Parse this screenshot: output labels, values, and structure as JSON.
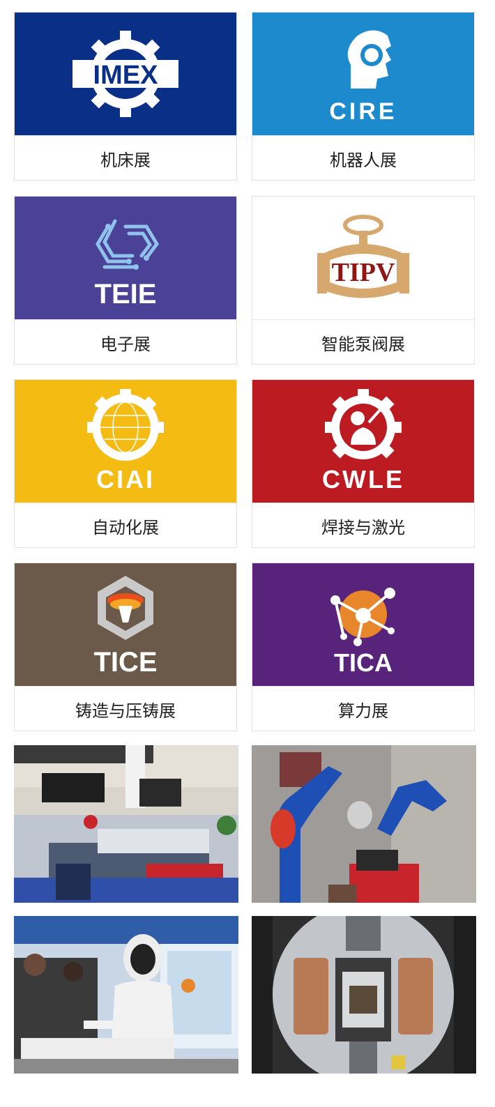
{
  "exhibitions": [
    {
      "name": "机床展",
      "logo_text": "IMEX",
      "bg": "#0A2F86"
    },
    {
      "name": "机器人展",
      "logo_text": "CIRE",
      "bg": "#1D8ACE"
    },
    {
      "name": "电子展",
      "logo_text": "TEIE",
      "bg": "#4B4196"
    },
    {
      "name": "智能泵阀展",
      "logo_text": "TIPV",
      "bg": "#FFFFFF"
    },
    {
      "name": "自动化展",
      "logo_text": "CIAI",
      "bg": "#F4BC12"
    },
    {
      "name": "焊接与激光",
      "logo_text": "CWLE",
      "bg": "#BC1B22"
    },
    {
      "name": "铸造与压铸展",
      "logo_text": "TICE",
      "bg": "#6B5A4A"
    },
    {
      "name": "算力展",
      "logo_text": "TICA",
      "bg": "#58237A"
    }
  ],
  "photos": [
    {
      "icon": "machine-tool-booth-photo"
    },
    {
      "icon": "welding-robot-photo"
    },
    {
      "icon": "humanoid-robot-photo"
    },
    {
      "icon": "industrial-equipment-photo"
    }
  ]
}
